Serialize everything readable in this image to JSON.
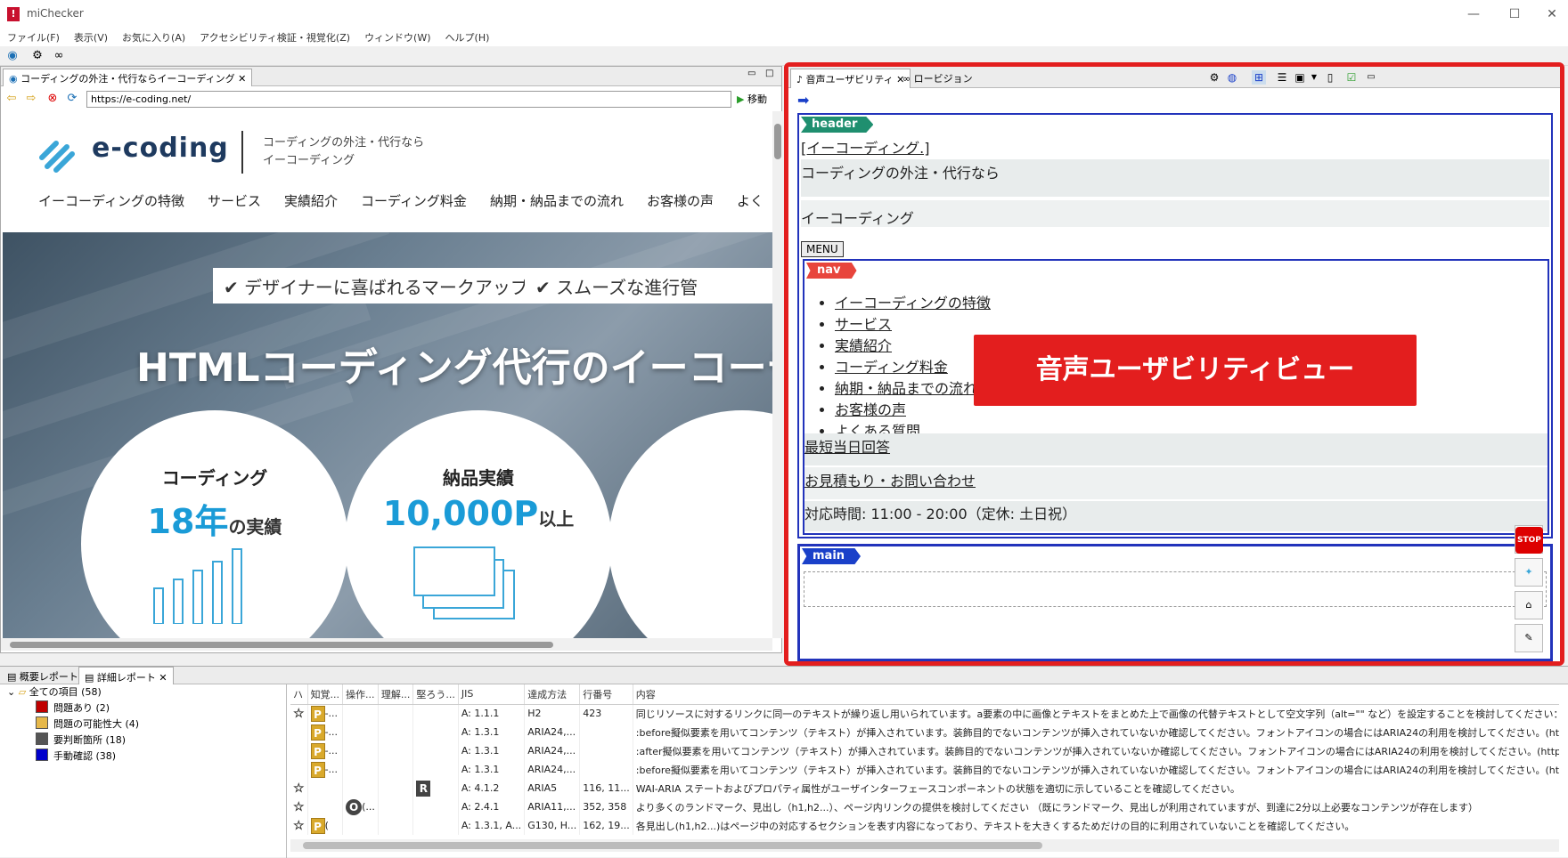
{
  "window": {
    "title": "miChecker",
    "minimize": "—",
    "maximize": "☐",
    "close": "✕"
  },
  "menu": [
    "ファイル(F)",
    "表示(V)",
    "お気に入り(A)",
    "アクセシビリティ検証・視覚化(Z)",
    "ウィンドウ(W)",
    "ヘルプ(H)"
  ],
  "browser": {
    "tab_label": "コーディングの外注・代行ならイーコーディング",
    "address": "https://e-coding.net/",
    "go_label": "移動"
  },
  "site": {
    "logo_text": "e-coding",
    "logo_sub1": "コーディングの外注・代行なら",
    "logo_sub2": "イーコーディング",
    "nav": [
      "イーコーディングの特徴",
      "サービス",
      "実績紹介",
      "コーディング料金",
      "納期・納品までの流れ",
      "お客様の声",
      "よく"
    ],
    "check1": "✔ デザイナーに喜ばれるマークアップ",
    "check2": "✔ スムーズな進行管",
    "hero_title": "HTMLコーディング代行のイーコーデ",
    "circle1_title": "コーディング",
    "circle1_big": "18年",
    "circle1_small": "の実績",
    "circle2_title": "納品実績",
    "circle2_big": "10,000P",
    "circle2_small": "以上"
  },
  "voice": {
    "tab_active": "音声ユーザビリティ",
    "tab_other": "ロービジョン",
    "header_tag": "header",
    "header_link": "[イーコーディング.]",
    "header_line1": "コーディングの外注・代行なら",
    "header_line2": "イーコーディング",
    "menu_button": "MENU",
    "nav_tag": "nav",
    "nav_items": [
      "イーコーディングの特徴",
      "サービス",
      "実績紹介",
      "コーディング料金",
      "納期・納品までの流れ",
      "お客様の声",
      "よくある質問"
    ],
    "link1": "最短当日回答",
    "link2": "お見積もり・お問い合わせ",
    "hours": "対応時間: 11:00 - 20:00（定休: 土日祝）",
    "main_tag": "main",
    "callout": "音声ユーザビリティビュー",
    "side_stop": "STOP"
  },
  "report": {
    "tab_summary": "概要レポート",
    "tab_detail": "詳細レポート",
    "tree": [
      {
        "label": "全ての項目 (58)",
        "color": ""
      },
      {
        "label": "問題あり (2)",
        "color": "#c00000"
      },
      {
        "label": "問題の可能性大 (4)",
        "color": "#e6b84a"
      },
      {
        "label": "要判断箇所 (18)",
        "color": "#555555"
      },
      {
        "label": "手動確認 (38)",
        "color": "#0000cc"
      }
    ],
    "columns": [
      "ハ",
      "知覚...",
      "操作...",
      "理解...",
      "堅ろう...",
      "JIS",
      "達成方法",
      "行番号",
      "内容"
    ],
    "rows": [
      {
        "star": "☆",
        "perc": "P",
        "perc_t": "-...",
        "op": "",
        "und": "",
        "rob": "",
        "jis": "A: 1.1.1",
        "tech": "H2",
        "line": "423",
        "desc": "同じリソースに対するリンクに同一のテキストが繰り返し用いられています。a要素の中に画像とテキストをまとめた上で画像の代替テキストとして空文字列（alt=\"\" など）を設定することを検討してください： \"お..."
      },
      {
        "star": "",
        "perc": "P",
        "perc_t": "-...",
        "op": "",
        "und": "",
        "rob": "",
        "jis": "A: 1.3.1",
        "tech": "ARIA24,...",
        "line": "",
        "desc": ":before擬似要素を用いてコンテンツ（テキスト）が挿入されています。装飾目的でないコンテンツが挿入されていないか確認してください。フォントアイコンの場合にはARIA24の利用を検討してください。(https://..."
      },
      {
        "star": "",
        "perc": "P",
        "perc_t": "-...",
        "op": "",
        "und": "",
        "rob": "",
        "jis": "A: 1.3.1",
        "tech": "ARIA24,...",
        "line": "",
        "desc": ":after擬似要素を用いてコンテンツ（テキスト）が挿入されています。装飾目的でないコンテンツが挿入されていないか確認してください。フォントアイコンの場合にはARIA24の利用を検討してください。(https://e-..."
      },
      {
        "star": "",
        "perc": "P",
        "perc_t": "-...",
        "op": "",
        "und": "",
        "rob": "",
        "jis": "A: 1.3.1",
        "tech": "ARIA24,...",
        "line": "",
        "desc": ":before擬似要素を用いてコンテンツ（テキスト）が挿入されています。装飾目的でないコンテンツが挿入されていないか確認してください。フォントアイコンの場合にはARIA24の利用を検討してください。(https://..."
      },
      {
        "star": "☆",
        "perc": "",
        "perc_t": "",
        "op": "",
        "und": "",
        "rob": "R",
        "jis": "A: 4.1.2",
        "tech": "ARIA5",
        "line": "116, 11...",
        "desc": "WAI-ARIA ステートおよびプロパティ属性がユーザインターフェースコンポーネントの状態を適切に示していることを確認してください。"
      },
      {
        "star": "☆",
        "perc": "",
        "perc_t": "",
        "op": "O",
        "und": "(...",
        "rob": "",
        "jis": "A: 2.4.1",
        "tech": "ARIA11,...",
        "line": "352, 358",
        "desc": "より多くのランドマーク、見出し（h1,h2...）、ページ内リンクの提供を検討してください （既にランドマーク、見出しが利用されていますが、到達に2分以上必要なコンテンツが存在します）"
      },
      {
        "star": "☆",
        "perc": "P",
        "perc_t": "(",
        "op": "",
        "und": "",
        "rob": "",
        "jis": "A: 1.3.1, A...",
        "tech": "G130, H...",
        "line": "162, 19...",
        "desc": "各見出し(h1,h2...)はページ中の対応するセクションを表す内容になっており、テキストを大きくするためだけの目的に利用されていないことを確認してください。"
      }
    ]
  }
}
